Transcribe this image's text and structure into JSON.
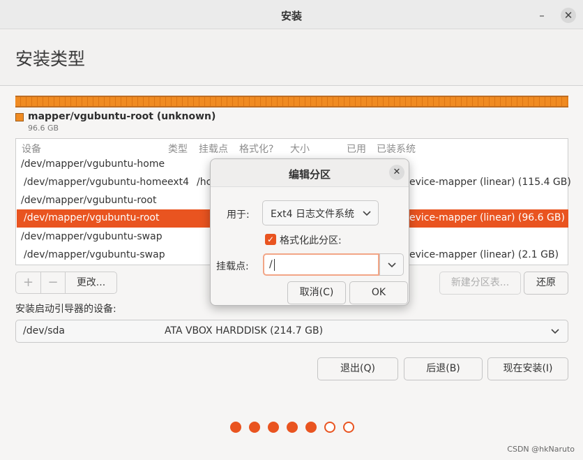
{
  "window": {
    "title": "安装"
  },
  "page": {
    "title": "安装类型"
  },
  "partition_bar": {
    "name": "mapper/vgubuntu-root (unknown)",
    "size": "96.6 GB",
    "color": "#f08b22"
  },
  "table": {
    "headers": [
      "设备",
      "类型",
      "挂载点",
      "格式化?",
      "大小",
      "已用",
      "已装系统"
    ],
    "rows": [
      {
        "device": "/dev/mapper/vgubuntu-home",
        "type": "",
        "mount": "",
        "system": ""
      },
      {
        "device": "/dev/mapper/vgubuntu-home",
        "type": "ext4",
        "mount": "/hc",
        "system": "evice-mapper (linear) (115.4 GB)"
      },
      {
        "device": "/dev/mapper/vgubuntu-root",
        "type": "",
        "mount": "",
        "system": ""
      },
      {
        "device": "/dev/mapper/vgubuntu-root",
        "type": "",
        "mount": "",
        "system": "evice-mapper (linear) (96.6 GB)",
        "selected": true
      },
      {
        "device": "/dev/mapper/vgubuntu-swap",
        "type": "",
        "mount": "",
        "system": ""
      },
      {
        "device": "/dev/mapper/vgubuntu-swap",
        "type": "",
        "mount": "",
        "system": "evice-mapper (linear) (2.1 GB)"
      }
    ]
  },
  "toolbar": {
    "add": "+",
    "remove": "−",
    "change": "更改...",
    "new_table": "新建分区表...",
    "revert": "还原"
  },
  "bootloader": {
    "label": "安装启动引导器的设备:",
    "device": "/dev/sda",
    "description": "ATA VBOX HARDDISK (214.7 GB)"
  },
  "actions": {
    "quit": "退出(Q)",
    "back": "后退(B)",
    "install": "现在安装(I)"
  },
  "progress": {
    "total_steps": 7,
    "completed_steps": 5
  },
  "dialog": {
    "title": "编辑分区",
    "use_as_label": "用于:",
    "use_as_value": "Ext4 日志文件系统",
    "format_label": "格式化此分区:",
    "format_checked": true,
    "mount_label": "挂载点:",
    "mount_value": "/",
    "cancel": "取消(C)",
    "ok": "OK"
  },
  "watermark": "CSDN @hkNaruto",
  "colors": {
    "accent": "#e95420",
    "partition": "#f08b22"
  }
}
